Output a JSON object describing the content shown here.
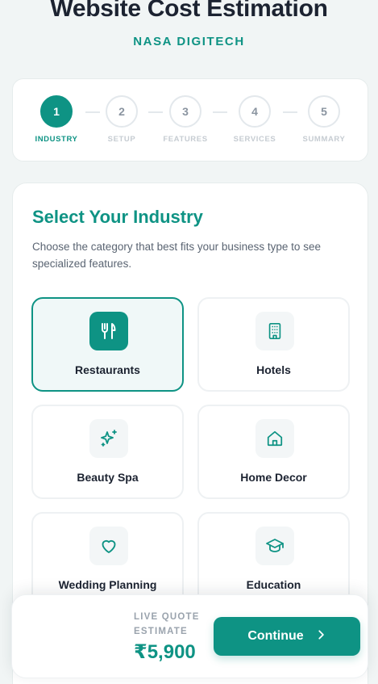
{
  "header": {
    "title": "Website Cost Estimation",
    "brand": "NASA DIGITECH"
  },
  "steps": [
    {
      "num": "1",
      "label": "INDUSTRY",
      "active": true
    },
    {
      "num": "2",
      "label": "SETUP",
      "active": false
    },
    {
      "num": "3",
      "label": "FEATURES",
      "active": false
    },
    {
      "num": "4",
      "label": "SERVICES",
      "active": false
    },
    {
      "num": "5",
      "label": "SUMMARY",
      "active": false
    }
  ],
  "main": {
    "title": "Select Your Industry",
    "subtitle": "Choose the category that best fits your business type to see specialized features."
  },
  "industries": [
    {
      "name": "Restaurants",
      "icon": "utensils-icon",
      "selected": true
    },
    {
      "name": "Hotels",
      "icon": "building-icon",
      "selected": false
    },
    {
      "name": "Beauty Spa",
      "icon": "sparkles-icon",
      "selected": false
    },
    {
      "name": "Home Decor",
      "icon": "home-icon",
      "selected": false
    },
    {
      "name": "Wedding Planning",
      "icon": "heart-icon",
      "selected": false
    },
    {
      "name": "Education",
      "icon": "graduation-cap-icon",
      "selected": false
    }
  ],
  "quote": {
    "label": "LIVE QUOTE ESTIMATE",
    "price": "₹5,900",
    "continue_label": "Continue"
  },
  "colors": {
    "accent": "#0e9384",
    "text_dark": "#1c2331",
    "muted": "#5a6472",
    "background": "#f1f5f5"
  }
}
